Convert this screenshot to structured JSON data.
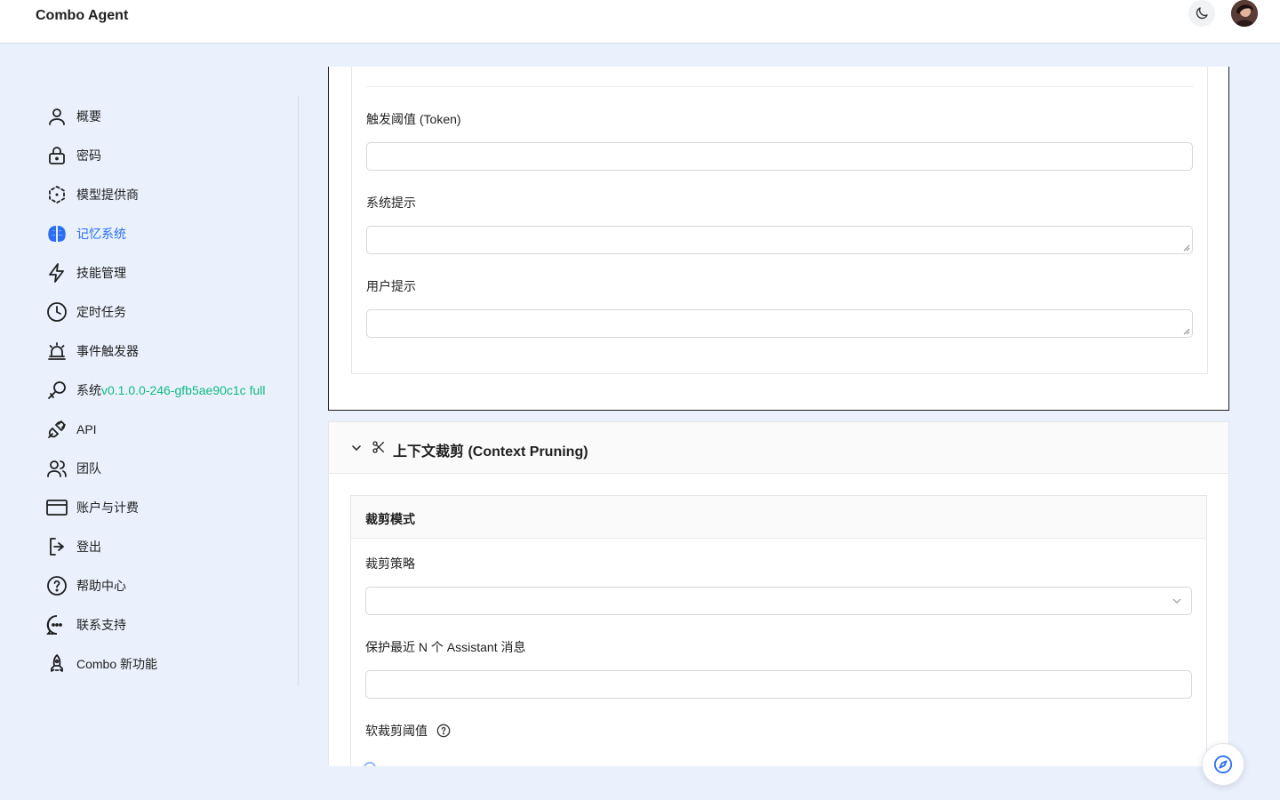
{
  "app": {
    "title": "Combo Agent"
  },
  "header": {
    "theme_icon": "moon-icon",
    "avatar_icon": "user-avatar"
  },
  "sidebar": {
    "items": [
      {
        "label": "概要",
        "icon": "user-icon"
      },
      {
        "label": "密码",
        "icon": "lock-icon"
      },
      {
        "label": "模型提供商",
        "icon": "model-provider-icon"
      },
      {
        "label": "记忆系统",
        "icon": "brain-icon",
        "active": true
      },
      {
        "label": "技能管理",
        "icon": "lightning-icon"
      },
      {
        "label": "定时任务",
        "icon": "clock-icon"
      },
      {
        "label": "事件触发器",
        "icon": "alarm-icon"
      },
      {
        "label": "系统",
        "icon": "key-icon",
        "version": "v0.1.0.0-246-gfb5ae90c1c full"
      },
      {
        "label": "API",
        "icon": "plug-icon"
      },
      {
        "label": "团队",
        "icon": "team-icon"
      },
      {
        "label": "账户与计费",
        "icon": "credit-card-icon"
      },
      {
        "label": "登出",
        "icon": "logout-icon"
      },
      {
        "label": "帮助中心",
        "icon": "help-circle-icon"
      },
      {
        "label": "联系支持",
        "icon": "chat-icon"
      },
      {
        "label": "Combo 新功能",
        "icon": "rocket-icon"
      }
    ],
    "active_color": "#2a6ff2",
    "version_color": "#10b981"
  },
  "memory_section": {
    "fields": [
      {
        "label": "触发阈值 (Token)",
        "value": "",
        "type": "input"
      },
      {
        "label": "系统提示",
        "value": "",
        "type": "textarea"
      },
      {
        "label": "用户提示",
        "value": "",
        "type": "textarea"
      }
    ]
  },
  "context_pruning": {
    "title": "上下文裁剪 (Context Pruning)",
    "card_title": "裁剪模式",
    "fields": [
      {
        "label": "裁剪策略",
        "value": "",
        "type": "select"
      },
      {
        "label": "保护最近 N 个 Assistant 消息",
        "value": "",
        "type": "input"
      },
      {
        "label": "软裁剪阈值",
        "type": "slider"
      }
    ]
  },
  "fab": {
    "icon": "compass-icon"
  }
}
